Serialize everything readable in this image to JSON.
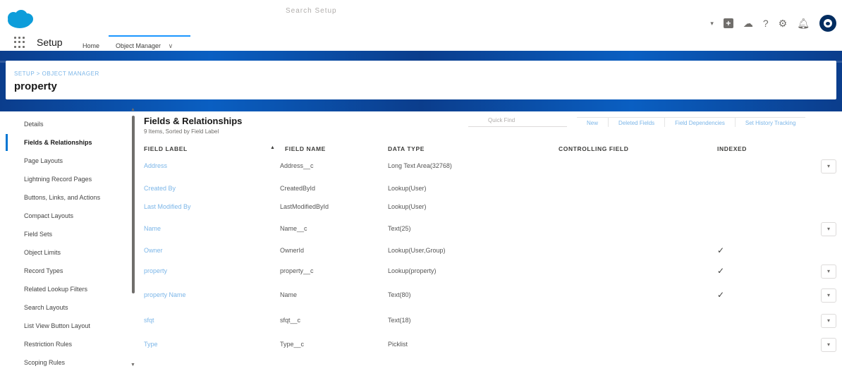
{
  "header": {
    "search_placeholder": "Search Setup",
    "icons": [
      "dropdown-caret-icon",
      "add-icon",
      "cloud-icon",
      "help-icon",
      "gear-icon",
      "bell-icon",
      "avatar"
    ]
  },
  "nav": {
    "app_name": "Setup",
    "home": "Home",
    "object_manager": "Object Manager"
  },
  "page": {
    "breadcrumb": "SETUP > OBJECT MANAGER",
    "title": "property"
  },
  "sidebar": {
    "items": [
      {
        "label": "Details"
      },
      {
        "label": "Fields & Relationships",
        "active": true
      },
      {
        "label": "Page Layouts"
      },
      {
        "label": "Lightning Record Pages"
      },
      {
        "label": "Buttons, Links, and Actions"
      },
      {
        "label": "Compact Layouts"
      },
      {
        "label": "Field Sets"
      },
      {
        "label": "Object Limits"
      },
      {
        "label": "Record Types"
      },
      {
        "label": "Related Lookup Filters"
      },
      {
        "label": "Search Layouts"
      },
      {
        "label": "List View Button Layout"
      },
      {
        "label": "Restriction Rules"
      },
      {
        "label": "Scoping Rules"
      }
    ]
  },
  "section": {
    "title": "Fields & Relationships",
    "subtitle": "9 Items, Sorted by Field Label",
    "quickfind": "Quick Find",
    "buttons": {
      "new": "New",
      "deleted": "Deleted Fields",
      "dependencies": "Field Dependencies",
      "history": "Set History Tracking"
    }
  },
  "table": {
    "headers": {
      "label": "FIELD LABEL",
      "name": "FIELD NAME",
      "type": "DATA TYPE",
      "controlling": "CONTROLLING FIELD",
      "indexed": "INDEXED"
    },
    "rows": [
      {
        "label": "Address",
        "name": "Address__c",
        "type": "Long Text Area(32768)",
        "indexed": false,
        "menu": true
      },
      {
        "label": "Created By",
        "name": "CreatedById",
        "type": "Lookup(User)",
        "indexed": false,
        "menu": false
      },
      {
        "label": "Last Modified By",
        "name": "LastModifiedById",
        "type": "Lookup(User)",
        "indexed": false,
        "menu": false
      },
      {
        "label": "Name",
        "name": "Name__c",
        "type": "Text(25)",
        "indexed": false,
        "menu": true
      },
      {
        "label": "Owner",
        "name": "OwnerId",
        "type": "Lookup(User,Group)",
        "indexed": true,
        "menu": false
      },
      {
        "label": "property",
        "name": "property__c",
        "type": "Lookup(property)",
        "indexed": true,
        "menu": true
      },
      {
        "label": "property Name",
        "name": "Name",
        "type": "Text(80)",
        "indexed": true,
        "menu": true
      },
      {
        "label": "sfqt",
        "name": "sfqt__c",
        "type": "Text(18)",
        "indexed": false,
        "menu": true
      },
      {
        "label": "Type",
        "name": "Type__c",
        "type": "Picklist",
        "indexed": false,
        "menu": true
      }
    ]
  }
}
